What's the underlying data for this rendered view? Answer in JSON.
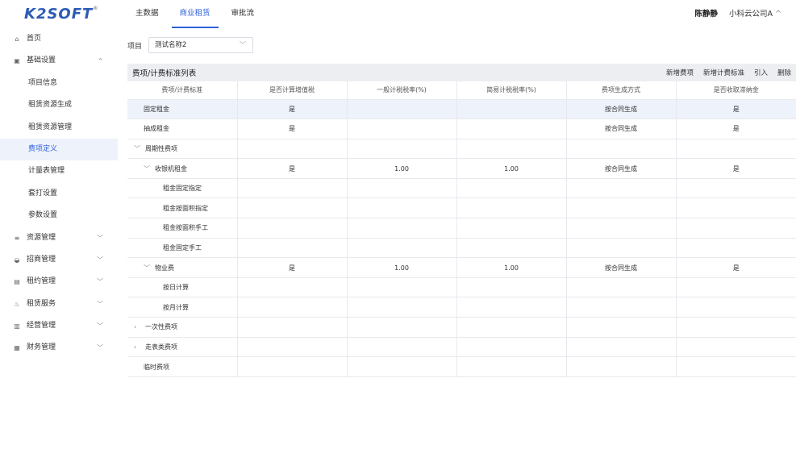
{
  "brand": {
    "logo": "K2SOFT",
    "mark": "®"
  },
  "topnav": [
    {
      "label": "主数据",
      "active": false
    },
    {
      "label": "商业租赁",
      "active": true
    },
    {
      "label": "审批流",
      "active": false
    }
  ],
  "user": {
    "name": "陈静静",
    "company": "小科云公司A",
    "caret": "^"
  },
  "sidebar": [
    {
      "label": "首页",
      "icon": "home-icon",
      "glyph": "⌂",
      "chev": ""
    },
    {
      "label": "基础设置",
      "icon": "settings-icon",
      "glyph": "▣",
      "chev": "^"
    },
    {
      "label": "项目信息",
      "sub": true
    },
    {
      "label": "租赁资源生成",
      "sub": true
    },
    {
      "label": "租赁资源管理",
      "sub": true
    },
    {
      "label": "费项定义",
      "sub": true,
      "active": true
    },
    {
      "label": "计量表管理",
      "sub": true
    },
    {
      "label": "套打设置",
      "sub": true
    },
    {
      "label": "参数设置",
      "sub": true
    },
    {
      "label": "资源管理",
      "icon": "database-icon",
      "glyph": "≡",
      "chev": "﹀"
    },
    {
      "label": "招商管理",
      "icon": "handshake-icon",
      "glyph": "◒",
      "chev": "﹀"
    },
    {
      "label": "租约管理",
      "icon": "contract-icon",
      "glyph": "▤",
      "chev": "﹀"
    },
    {
      "label": "租赁服务",
      "icon": "service-icon",
      "glyph": "♨",
      "chev": "﹀"
    },
    {
      "label": "经营管理",
      "icon": "chart-icon",
      "glyph": "▥",
      "chev": "﹀"
    },
    {
      "label": "财务管理",
      "icon": "finance-icon",
      "glyph": "▦",
      "chev": "﹀"
    }
  ],
  "filter": {
    "label": "项目",
    "value": "测试名称2",
    "arrow": "﹀"
  },
  "panel": {
    "title": "费项/计费标准列表",
    "actions": [
      "新增费项",
      "新增计费标准",
      "引入",
      "删除"
    ]
  },
  "table": {
    "columns": [
      "费项/计费标准",
      "是否计算增值税",
      "一般计税税率(%)",
      "简易计税税率(%)",
      "费项生成方式",
      "是否收取滞纳金"
    ],
    "rows": [
      {
        "name": "固定租金",
        "level": 0,
        "toggle": "",
        "vat": "是",
        "general": "",
        "simple": "",
        "gen": "按合同生成",
        "late": "是",
        "selected": true
      },
      {
        "name": "抽成租金",
        "level": 0,
        "toggle": "",
        "vat": "是",
        "general": "",
        "simple": "",
        "gen": "按合同生成",
        "late": "是"
      },
      {
        "name": "周期性费项",
        "level": 0,
        "toggle": "﹀",
        "vat": "",
        "general": "",
        "simple": "",
        "gen": "",
        "late": ""
      },
      {
        "name": "收银机租金",
        "level": 1,
        "toggle": "﹀",
        "vat": "是",
        "general": "1.00",
        "simple": "1.00",
        "gen": "按合同生成",
        "late": "是"
      },
      {
        "name": "租金固定指定",
        "level": 2,
        "toggle": "",
        "vat": "",
        "general": "",
        "simple": "",
        "gen": "",
        "late": ""
      },
      {
        "name": "租金按面积指定",
        "level": 2,
        "toggle": "",
        "vat": "",
        "general": "",
        "simple": "",
        "gen": "",
        "late": ""
      },
      {
        "name": "租金按面积手工",
        "level": 2,
        "toggle": "",
        "vat": "",
        "general": "",
        "simple": "",
        "gen": "",
        "late": ""
      },
      {
        "name": "租金固定手工",
        "level": 2,
        "toggle": "",
        "vat": "",
        "general": "",
        "simple": "",
        "gen": "",
        "late": ""
      },
      {
        "name": "物业费",
        "level": 1,
        "toggle": "﹀",
        "vat": "是",
        "general": "1.00",
        "simple": "1.00",
        "gen": "按合同生成",
        "late": "是"
      },
      {
        "name": "按日计算",
        "level": 2,
        "toggle": "",
        "vat": "",
        "general": "",
        "simple": "",
        "gen": "",
        "late": ""
      },
      {
        "name": "按月计算",
        "level": 2,
        "toggle": "",
        "vat": "",
        "general": "",
        "simple": "",
        "gen": "",
        "late": ""
      },
      {
        "name": "一次性费项",
        "level": 0,
        "toggle": "›",
        "vat": "",
        "general": "",
        "simple": "",
        "gen": "",
        "late": ""
      },
      {
        "name": "走表类费项",
        "level": 0,
        "toggle": "›",
        "vat": "",
        "general": "",
        "simple": "",
        "gen": "",
        "late": ""
      },
      {
        "name": "临时费项",
        "level": 0,
        "toggle": "",
        "vat": "",
        "general": "",
        "simple": "",
        "gen": "",
        "late": ""
      }
    ]
  },
  "colors": {
    "accent": "#2f62d8",
    "brand": "#2d5bb5",
    "selected_bg": "#eef2fb"
  }
}
